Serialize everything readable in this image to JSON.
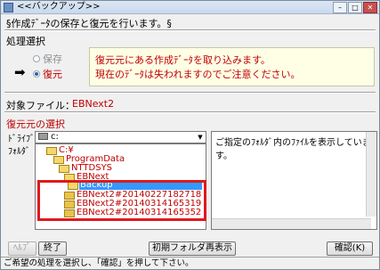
{
  "window": {
    "title": "<<バックアップ>>"
  },
  "header": {
    "description": "§作成ﾃﾞｰﾀの保存と復元を行います。§"
  },
  "process": {
    "label": "処理選択",
    "options": [
      {
        "label": "保存",
        "selected": false
      },
      {
        "label": "復元",
        "selected": true
      }
    ],
    "note_lines": [
      "復元元にある作成ﾃﾞｰﾀを取り込みます。",
      "現在のﾃﾞｰﾀは失われますのでご注意ください。"
    ]
  },
  "target": {
    "label": "対象ファイル：",
    "value": "EBNext2"
  },
  "source": {
    "label": "復元元の選択",
    "drive_label": "ﾄﾞﾗｲﾌﾞ",
    "folder_label": "ﾌｫﾙﾀﾞ",
    "drive_value": "c:",
    "tree": [
      {
        "label": "C:¥",
        "level": 0
      },
      {
        "label": "ProgramData",
        "level": 1
      },
      {
        "label": "NTTDSYS",
        "level": 2
      },
      {
        "label": "EBNext",
        "level": 3
      },
      {
        "label": "Backup",
        "level": 4,
        "selected": true
      },
      {
        "label": "EBNext2#20140227182718",
        "level": 5
      },
      {
        "label": "EBNext2#20140314165319",
        "level": 5
      },
      {
        "label": "EBNext2#20140314165352",
        "level": 5
      }
    ],
    "file_hint": "ご指定のﾌｫﾙﾀﾞ内のﾌｧｲﾙを表示しています。"
  },
  "buttons": {
    "help": "ﾍﾙﾌﾟ",
    "exit": "終了",
    "reset_folder": "初期フォルダ再表示",
    "confirm": "確認(K)"
  },
  "status": "ご希望の処理を選択し、「確認」を押して下さい。",
  "colors": {
    "accent_red": "#c00000",
    "highlight_box": "#e0191d",
    "selection": "#3399ff",
    "note_bg": "#ffffe6"
  }
}
